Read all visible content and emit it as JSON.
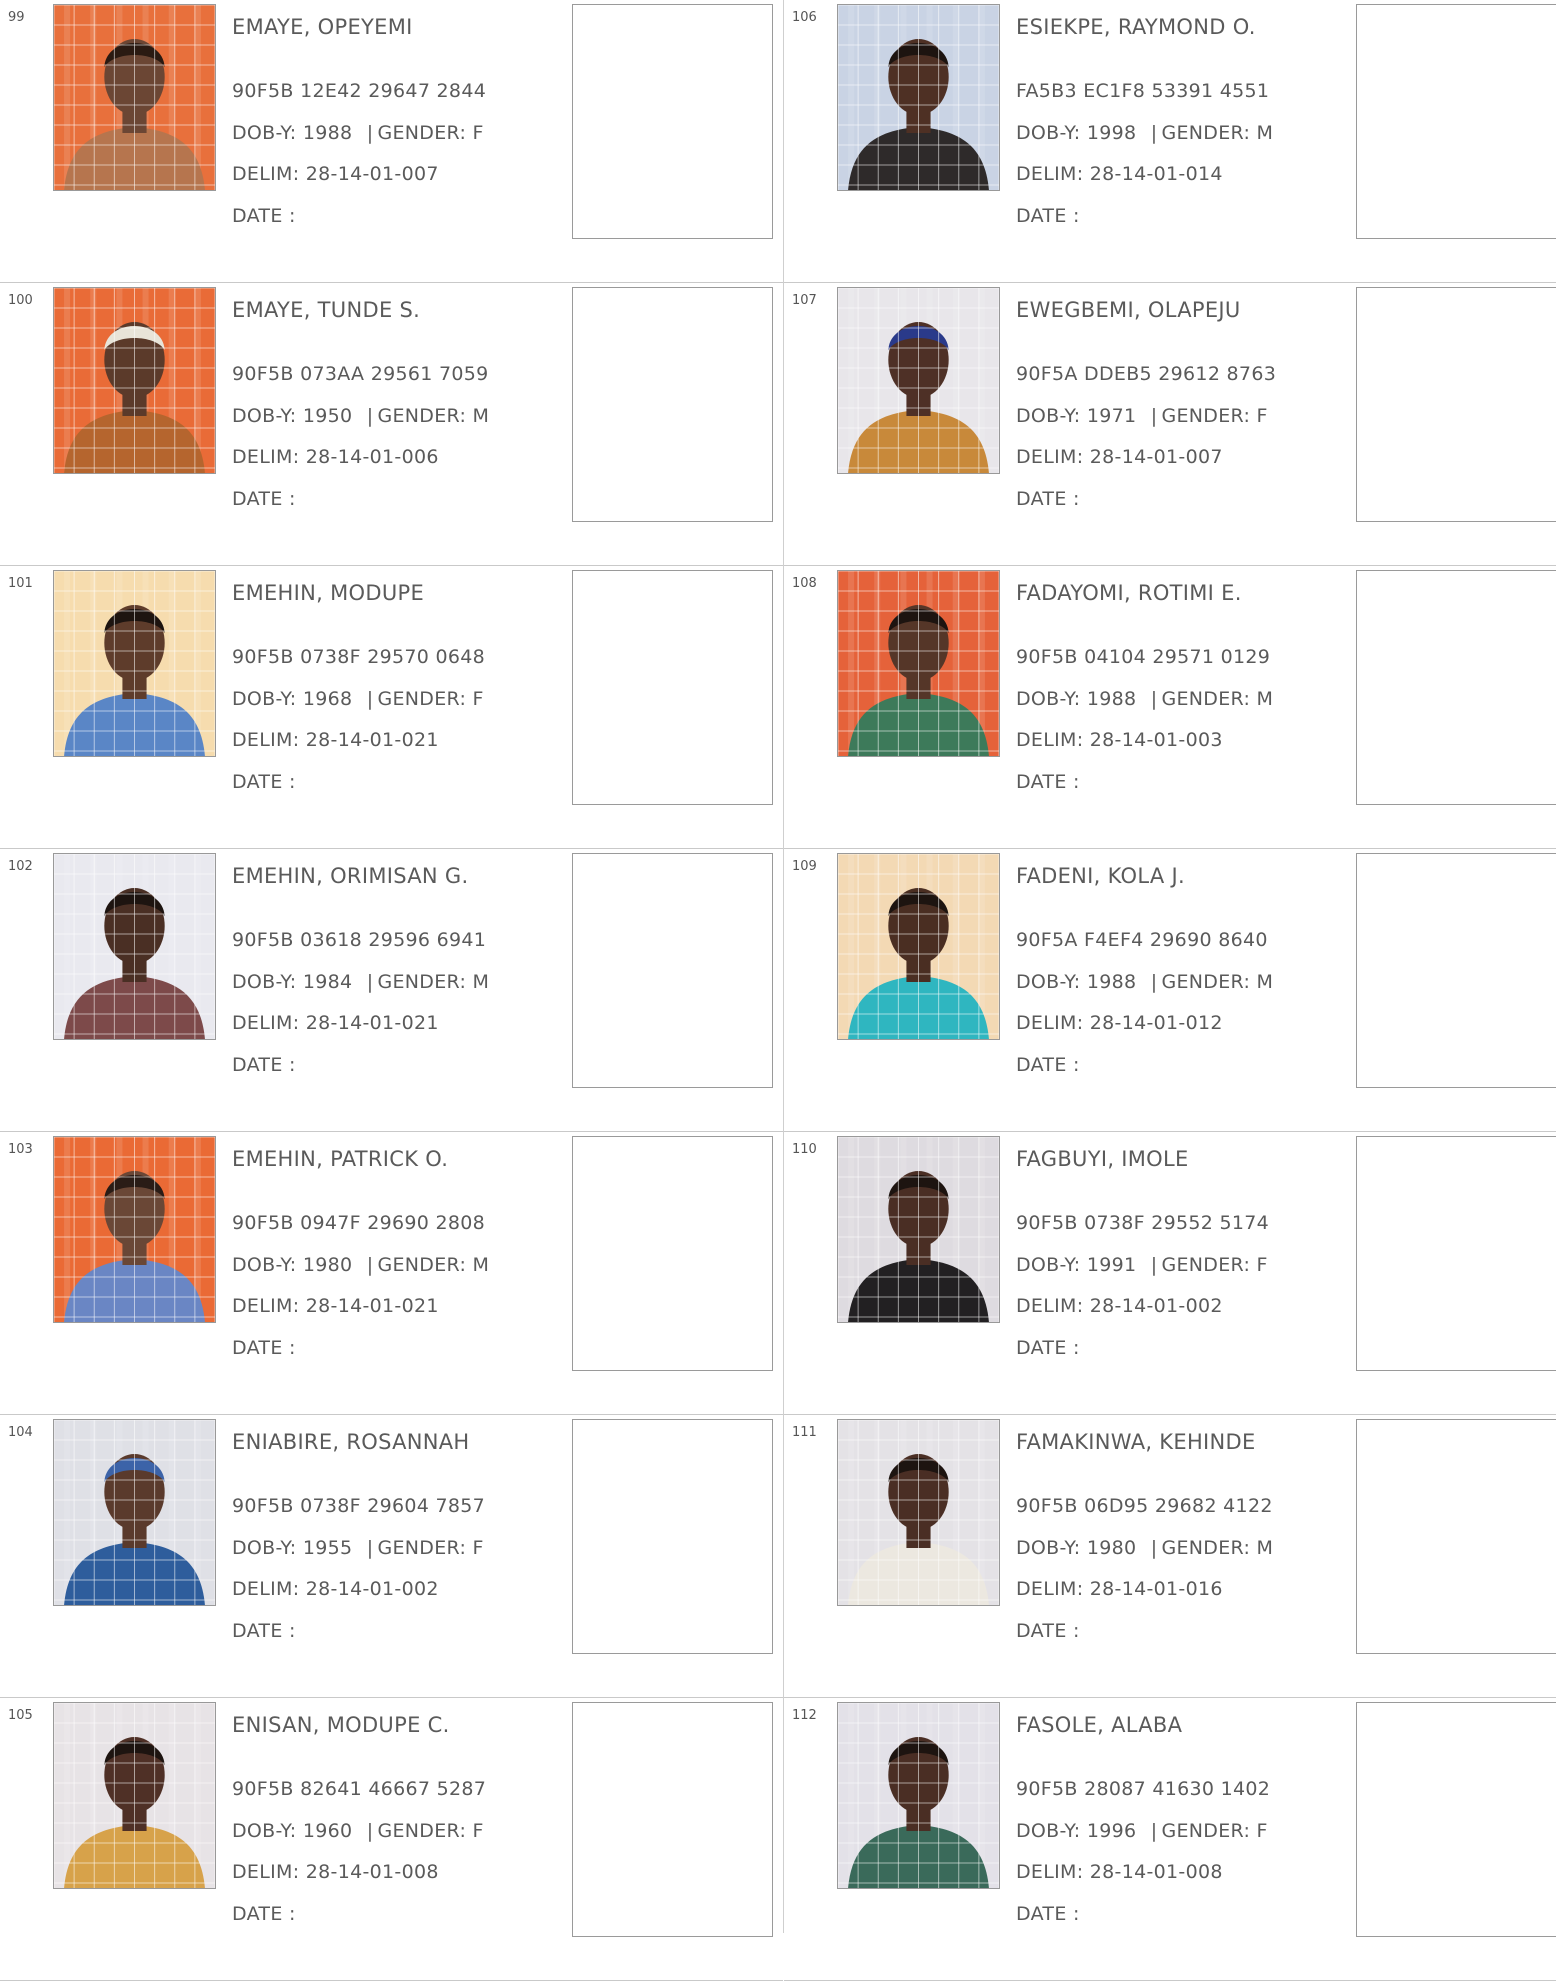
{
  "labels": {
    "dob": "DOB-Y:",
    "gender": "GENDER:",
    "delim": "DELIM:",
    "date": "DATE",
    "date_colon": ":",
    "bar": "|"
  },
  "left_column": [
    {
      "serial": "99",
      "name": "EMAYE, OPEYEMI",
      "vin": "90F5B 12E42 29647 2844",
      "dob": "1988",
      "gender": "F",
      "delim": "28-14-01-007",
      "photo": {
        "bg": "#e8703c",
        "skin": "#6b4634",
        "cloth": "#b6754e",
        "hair": "#2a1a12"
      }
    },
    {
      "serial": "100",
      "name": "EMAYE, TUNDE S.",
      "vin": "90F5B 073AA 29561 7059",
      "dob": "1950",
      "gender": "M",
      "delim": "28-14-01-006",
      "photo": {
        "bg": "#e96b37",
        "skin": "#5b3a2a",
        "cloth": "#b5652e",
        "hair": "#e8e4d8"
      }
    },
    {
      "serial": "101",
      "name": "EMEHIN, MODUPE",
      "vin": "90F5B 0738F 29570 0648",
      "dob": "1968",
      "gender": "F",
      "delim": "28-14-01-021",
      "photo": {
        "bg": "#f6dcae",
        "skin": "#5e3c2b",
        "cloth": "#5a86c6",
        "hair": "#1d1410"
      }
    },
    {
      "serial": "102",
      "name": "EMEHIN, ORIMISAN G.",
      "vin": "90F5B 03618 29596 6941",
      "dob": "1984",
      "gender": "M",
      "delim": "28-14-01-021",
      "photo": {
        "bg": "#e9e9ef",
        "skin": "#4a2f24",
        "cloth": "#7d4a4a",
        "hair": "#1d1410"
      }
    },
    {
      "serial": "103",
      "name": "EMEHIN, PATRICK O.",
      "vin": "90F5B 0947F 29690 2808",
      "dob": "1980",
      "gender": "M",
      "delim": "28-14-01-021",
      "photo": {
        "bg": "#ea6a35",
        "skin": "#6a4736",
        "cloth": "#6a86c4",
        "hair": "#2a1c16"
      }
    },
    {
      "serial": "104",
      "name": "ENIABIRE, ROSANNAH",
      "vin": "90F5B 0738F 29604 7857",
      "dob": "1955",
      "gender": "F",
      "delim": "28-14-01-002",
      "photo": {
        "bg": "#dfe0e6",
        "skin": "#5a3a2c",
        "cloth": "#2e5d9c",
        "hair": "#3c63a8"
      }
    },
    {
      "serial": "105",
      "name": "ENISAN, MODUPE C.",
      "vin": "90F5B 82641 46667 5287",
      "dob": "1960",
      "gender": "F",
      "delim": "28-14-01-008",
      "photo": {
        "bg": "#e7e3e6",
        "skin": "#4f3026",
        "cloth": "#d7a24a",
        "hair": "#1d1410"
      }
    }
  ],
  "right_column": [
    {
      "serial": "106",
      "name": "ESIEKPE, RAYMOND O.",
      "vin": "FA5B3 EC1F8 53391 4551",
      "dob": "1998",
      "gender": "M",
      "delim": "28-14-01-014",
      "photo": {
        "bg": "#c9d3e4",
        "skin": "#4e3024",
        "cloth": "#2e2a2a",
        "hair": "#1d1410"
      }
    },
    {
      "serial": "107",
      "name": "EWEGBEMI, OLAPEJU",
      "vin": "90F5A DDEB5 29612 8763",
      "dob": "1971",
      "gender": "F",
      "delim": "28-14-01-007",
      "photo": {
        "bg": "#e8e6ea",
        "skin": "#4e3026",
        "cloth": "#c8893a",
        "hair": "#2a3a8a"
      }
    },
    {
      "serial": "108",
      "name": "FADAYOMI, ROTIMI E.",
      "vin": "90F5B 04104 29571 0129",
      "dob": "1988",
      "gender": "M",
      "delim": "28-14-01-003",
      "photo": {
        "bg": "#e5623a",
        "skin": "#553628",
        "cloth": "#3d7a5a",
        "hair": "#1d1410"
      }
    },
    {
      "serial": "109",
      "name": "FADENI, KOLA J.",
      "vin": "90F5A F4EF4 29690 8640",
      "dob": "1988",
      "gender": "M",
      "delim": "28-14-01-012",
      "photo": {
        "bg": "#f3d9b4",
        "skin": "#4a2e22",
        "cloth": "#2fb6c0",
        "hair": "#1d1410"
      }
    },
    {
      "serial": "110",
      "name": "FAGBUYI, IMOLE",
      "vin": "90F5B 0738F 29552 5174",
      "dob": "1991",
      "gender": "F",
      "delim": "28-14-01-002",
      "photo": {
        "bg": "#dedbe0",
        "skin": "#4a2e24",
        "cloth": "#222022",
        "hair": "#1d1410"
      }
    },
    {
      "serial": "111",
      "name": "FAMAKINWA, KEHINDE",
      "vin": "90F5B 06D95 29682 4122",
      "dob": "1980",
      "gender": "M",
      "delim": "28-14-01-016",
      "photo": {
        "bg": "#e4e2e6",
        "skin": "#4a2e24",
        "cloth": "#ece8e0",
        "hair": "#1d1410"
      }
    },
    {
      "serial": "112",
      "name": "FASOLE, ALABA",
      "vin": "90F5B 28087 41630 1402",
      "dob": "1996",
      "gender": "F",
      "delim": "28-14-01-008",
      "photo": {
        "bg": "#e3e1e8",
        "skin": "#4a2e24",
        "cloth": "#3a6a5a",
        "hair": "#1d1410"
      }
    }
  ]
}
